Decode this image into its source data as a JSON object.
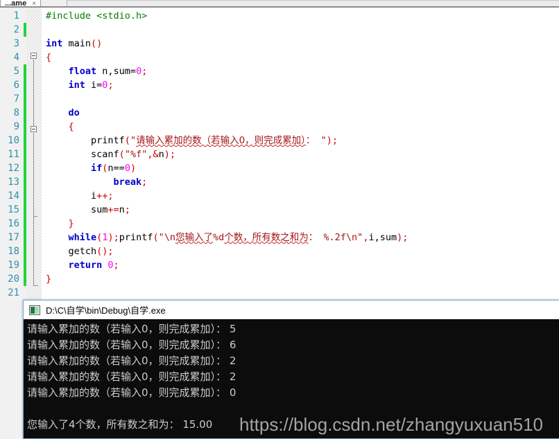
{
  "editor": {
    "tab": {
      "label": "...ame",
      "close_glyph": "×"
    },
    "lines": [
      {
        "n": "1",
        "text": "#include <stdio.h>"
      },
      {
        "n": "2",
        "text": ""
      },
      {
        "n": "3",
        "text": "int main()"
      },
      {
        "n": "4",
        "text": "{"
      },
      {
        "n": "5",
        "text": "    float n,sum=0;"
      },
      {
        "n": "6",
        "text": "    int i=0;"
      },
      {
        "n": "7",
        "text": ""
      },
      {
        "n": "8",
        "text": "    do"
      },
      {
        "n": "9",
        "text": "    {"
      },
      {
        "n": "10",
        "text": "        printf(\"请输入累加的数（若输入0，则完成累加）： \");"
      },
      {
        "n": "11",
        "text": "        scanf(\"%f\",&n);"
      },
      {
        "n": "12",
        "text": "        if(n==0)"
      },
      {
        "n": "13",
        "text": "            break;"
      },
      {
        "n": "14",
        "text": "        i++;"
      },
      {
        "n": "15",
        "text": "        sum+=n;"
      },
      {
        "n": "16",
        "text": "    }"
      },
      {
        "n": "17",
        "text": "    while(1);printf(\"\\n您输入了%d个数，所有数之和为： %.2f\\n\",i,sum);"
      },
      {
        "n": "18",
        "text": "    getch();"
      },
      {
        "n": "19",
        "text": "    return 0;"
      },
      {
        "n": "20",
        "text": "}"
      },
      {
        "n": "21",
        "text": ""
      }
    ]
  },
  "console": {
    "title": "D:\\C\\自学\\bin\\Debug\\自学.exe",
    "icon": "console-app-icon",
    "output": [
      "请输入累加的数（若输入0，则完成累加）： 5",
      "请输入累加的数（若输入0，则完成累加）： 6",
      "请输入累加的数（若输入0，则完成累加）： 2",
      "请输入累加的数（若输入0，则完成累加）： 2",
      "请输入累加的数（若输入0，则完成累加）： 0",
      "",
      "您输入了4个数，所有数之和为： 15.00"
    ]
  },
  "watermark": {
    "text": "https://blog.csdn.net/zhangyuxuan510"
  },
  "colors": {
    "keyword": "#0000cd",
    "preprocessor": "#008000",
    "string": "#a31515",
    "number": "#ff00ff",
    "punctuation": "#cc0000",
    "line_number": "#2b91af",
    "change_bar": "#1fd53a",
    "console_bg": "#0c0c0c",
    "console_fg": "#cccccc",
    "window_border": "#6fa8dc"
  }
}
